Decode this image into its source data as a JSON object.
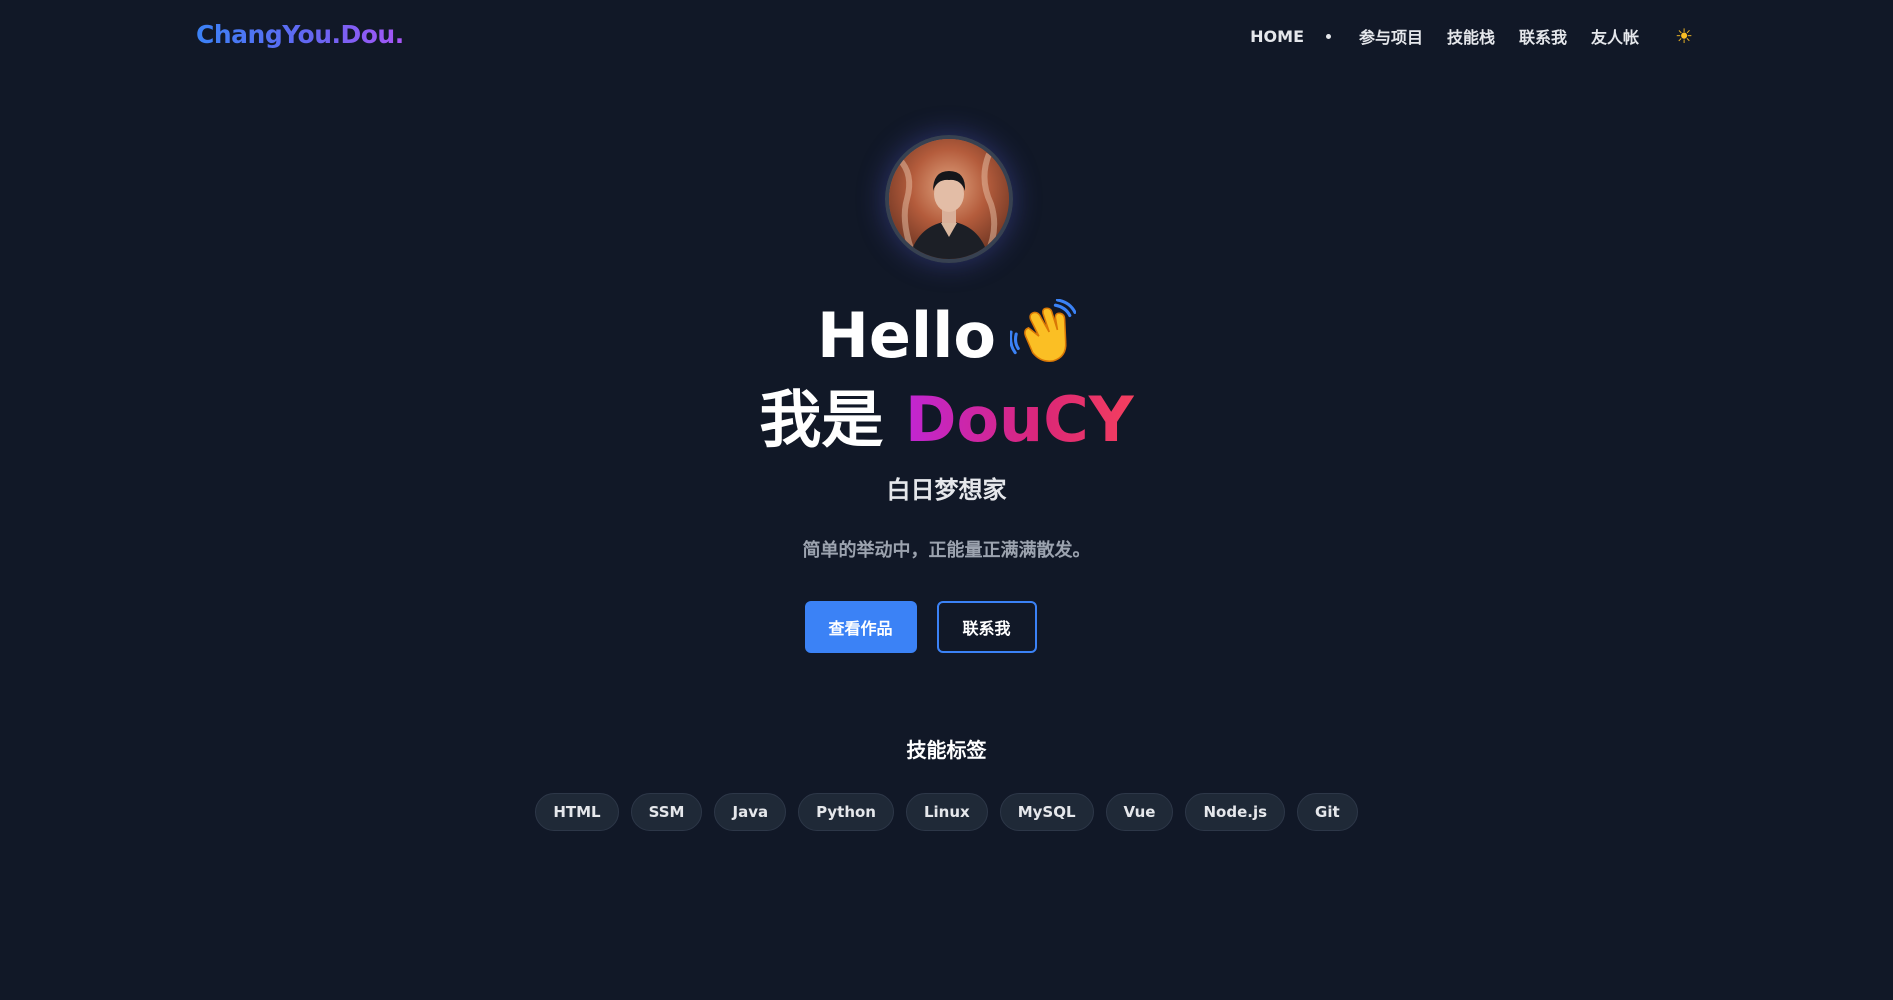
{
  "header": {
    "logo": "ChangYou.Dou.",
    "nav": [
      "HOME",
      "参与项目",
      "技能栈",
      "联系我",
      "友人帐"
    ],
    "theme_icon": "sun-icon"
  },
  "hero": {
    "avatar_icon": "profile-photo",
    "hello": "Hello",
    "wave_icon": "waving-hand-icon",
    "iam_prefix": "我是",
    "name": "DouCY",
    "subtitle": "白日梦想家",
    "tagline": "简单的举动中，正能量正满满散发。",
    "primary_button": "查看作品",
    "secondary_button": "联系我"
  },
  "skills": {
    "title": "技能标签",
    "tags": [
      "HTML",
      "SSM",
      "Java",
      "Python",
      "Linux",
      "MySQL",
      "Vue",
      "Node.js",
      "Git"
    ]
  },
  "colors": {
    "background": "#111827",
    "accent": "#3b82f6",
    "name_gradient_start": "#c026d3",
    "name_gradient_end": "#f43f5e",
    "sun": "#fbbf24"
  }
}
